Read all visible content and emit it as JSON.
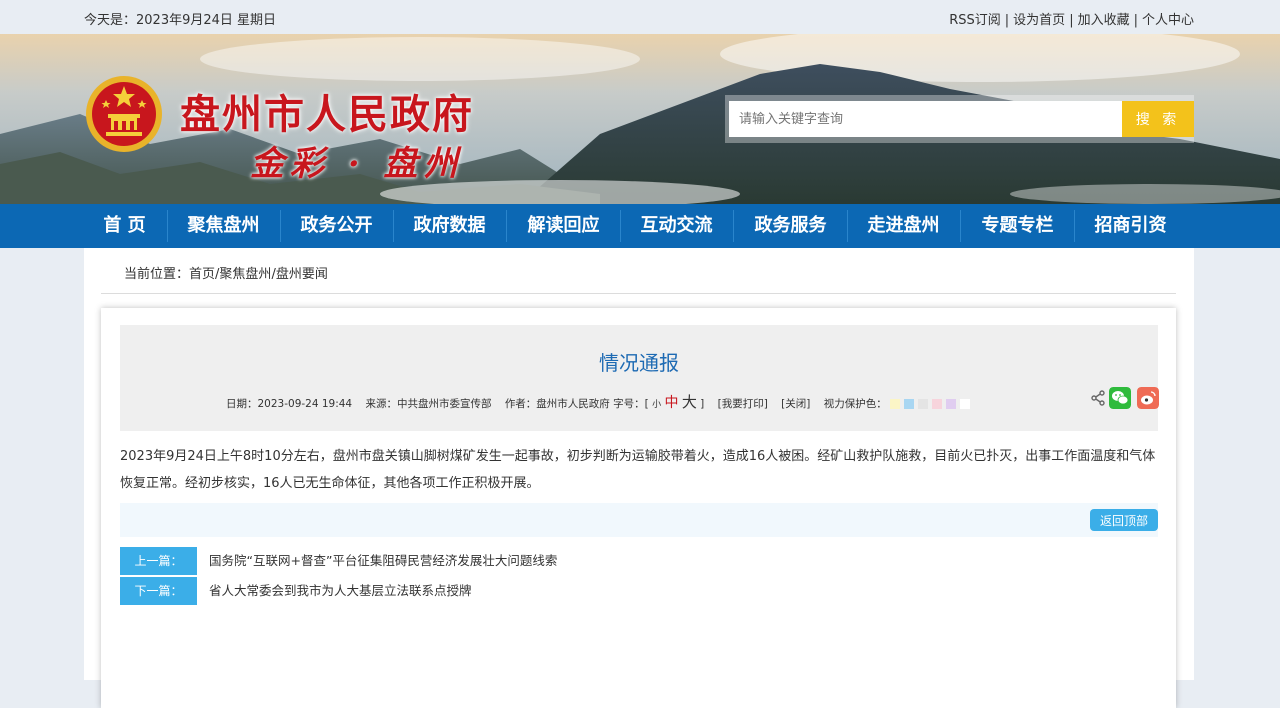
{
  "topbar": {
    "date": "今天是：2023年9月24日 星期日",
    "links": [
      "RSS订阅",
      "设为首页",
      "加入收藏",
      "个人中心"
    ],
    "separator": "|"
  },
  "header": {
    "title": "盘州市人民政府",
    "slogan": "金彩 · 盘州",
    "emblem_icon": "national-emblem-icon",
    "search": {
      "placeholder": "请输入关键字查询",
      "button": "搜 索"
    }
  },
  "nav": {
    "items": [
      "首 页",
      "聚焦盘州",
      "政务公开",
      "政府数据",
      "解读回应",
      "互动交流",
      "政务服务",
      "走进盘州",
      "专题专栏",
      "招商引资"
    ]
  },
  "breadcrumb": {
    "prefix": "当前位置：",
    "items": [
      "首页",
      "聚焦盘州",
      "盘州要闻"
    ],
    "separator": "/"
  },
  "article": {
    "title": "情况通报",
    "meta": {
      "date": "日期：2023-09-24 19:44",
      "source": "来源：中共盘州市委宣传部",
      "author": "作者：盘州市人民政府",
      "fontsize_label": "字号：[",
      "fs_small": "小",
      "fs_mid": "中",
      "fs_big": "大",
      "fontsize_end": "]",
      "print": "[我要打印]",
      "close": "[关闭]",
      "eye_label": "视力保护色："
    },
    "eye_colors": [
      "#fbf5c6",
      "#a8d6f2",
      "#e4e4e4",
      "#f7d4dc",
      "#e0cdf0",
      "#ffffff"
    ],
    "share_icons": [
      "share-icon",
      "wechat-icon",
      "weibo-icon"
    ],
    "body": "2023年9月24日上午8时10分左右，盘州市盘关镇山脚树煤矿发生一起事故，初步判断为运输胶带着火，造成16人被困。经矿山救护队施救，目前火已扑灭，出事工作面温度和气体恢复正常。经初步核实，16人已无生命体征，其他各项工作正积极开展。",
    "back_to_top": "返回顶部",
    "prev": {
      "label": "上一篇：",
      "title": "国务院“互联网+督查”平台征集阻碍民营经济发展壮大问题线索"
    },
    "next": {
      "label": "下一篇：",
      "title": "省人大常委会到我市为人大基层立法联系点授牌"
    }
  },
  "colors": {
    "nav_bg": "#0c68b4",
    "title_red": "#c8161d",
    "accent_blue": "#3baee8",
    "search_btn": "#f3c21b"
  }
}
